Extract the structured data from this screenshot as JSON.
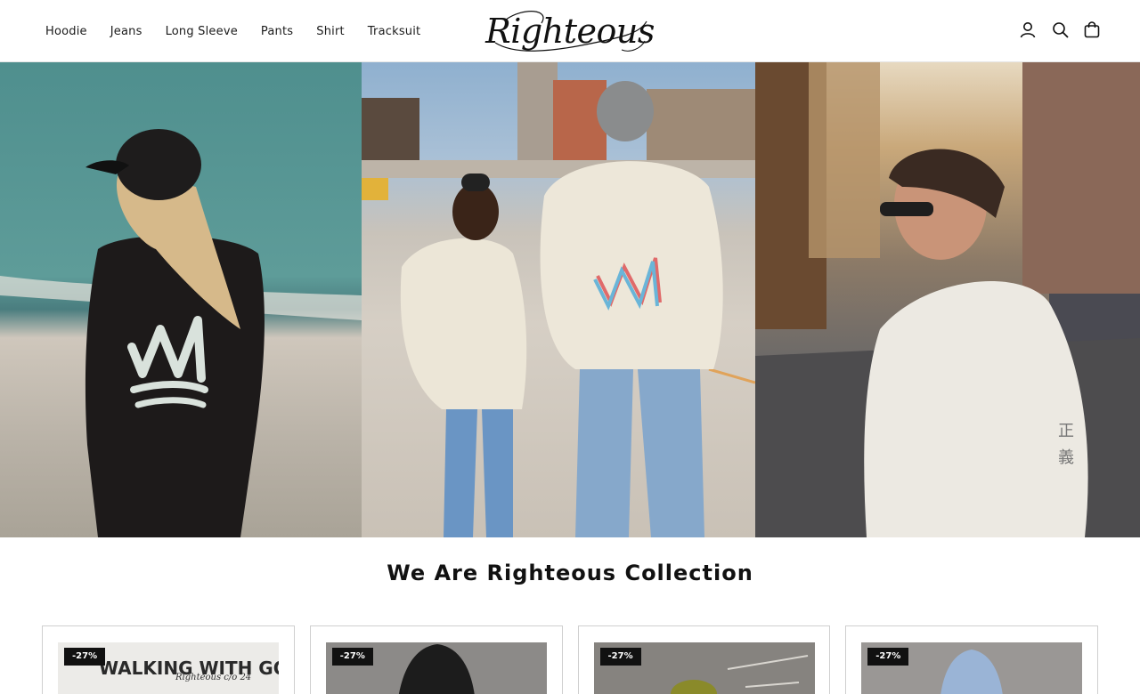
{
  "nav": {
    "items": [
      {
        "label": "Hoodie"
      },
      {
        "label": "Jeans"
      },
      {
        "label": "Long Sleeve"
      },
      {
        "label": "Pants"
      },
      {
        "label": "Shirt"
      },
      {
        "label": "Tracksuit"
      }
    ]
  },
  "brand": {
    "logo_text": "Righteous"
  },
  "header_icons": [
    "account-icon",
    "search-icon",
    "cart-icon"
  ],
  "hero": {
    "panels": [
      "hoodie-beach-photo",
      "hoodie-parking-lot-photo",
      "hoodie-city-street-photo"
    ]
  },
  "collection": {
    "title": "We Are Righteous Collection",
    "cards": [
      {
        "badge": "-27%",
        "image_text": "WALKING WITH GOD",
        "image_script": "Righteous c/o 24"
      },
      {
        "badge": "-27%"
      },
      {
        "badge": "-27%"
      },
      {
        "badge": "-27%"
      }
    ]
  },
  "colors": {
    "text": "#111111",
    "badge_bg": "#111111",
    "badge_text": "#ffffff",
    "card_border": "#cfcfcf"
  }
}
